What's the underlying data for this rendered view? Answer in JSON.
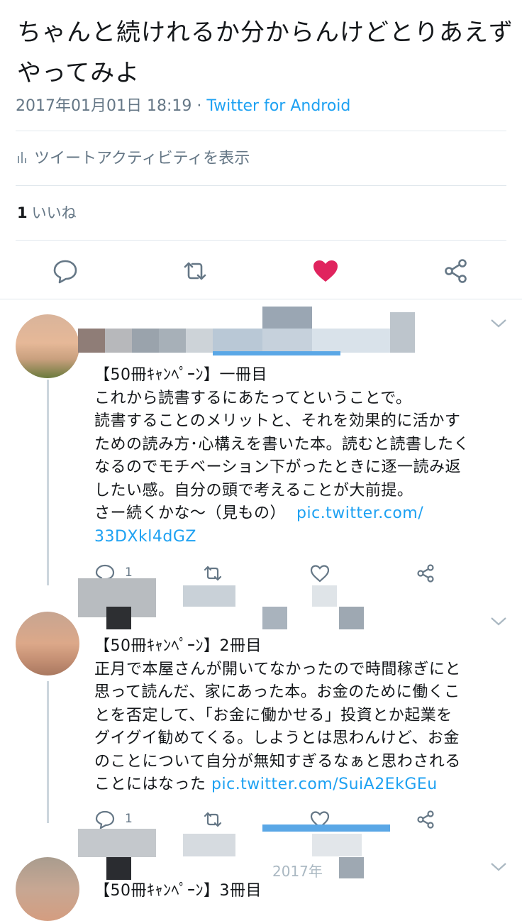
{
  "main_tweet": {
    "text": "ちゃんと続けれるか分からんけどとりあえずやってみよ",
    "timestamp": "2017年01月01日 18:19",
    "separator": " · ",
    "source": "Twitter for Android",
    "activity_label": "ツイートアクティビティを表示",
    "like_count": "1",
    "like_label": "いいね",
    "icons": [
      "reply-icon",
      "retweet-icon",
      "like-icon-filled",
      "share-icon"
    ],
    "like_color": "#e0245e"
  },
  "replies": [
    {
      "title": "【50冊ｷｬﾝﾍﾟｰﾝ】一冊目",
      "body_lines": [
        "これから読書するにあたってということで。",
        "読書することのメリットと、それを効果的に活かす",
        "ための読み方･心構えを書いた本。読むと読書したく",
        "なるのでモチベーション下がったときに逐一読み返",
        "したい感。自分の頭で考えることが大前提。"
      ],
      "last_line": "さー続くかな〜（見もの）",
      "link_part1": "pic.twitter.com/",
      "link_part2": "33DXkl4dGZ",
      "reply_count": "1"
    },
    {
      "title": "【50冊ｷｬﾝﾍﾟｰﾝ】2冊目",
      "body_lines": [
        "正月で本屋さんが開いてなかったので時間稼ぎにと",
        "思って読んだ、家にあった本。お金のために働くこ",
        "とを否定して、「お金に働かせる」投資とか起業を",
        "グイグイ勧めてくる。しようとは思わんけど、お金",
        "のことについて自分が無知すぎるなぁと思わされる"
      ],
      "last_line": "ことにはなった",
      "link": "pic.twitter.com/SuiA2EkGEu",
      "reply_count": "1"
    },
    {
      "title": "【50冊ｷｬﾝﾍﾟｰﾝ】3冊目",
      "timestamp_partial": "2017年"
    }
  ],
  "colors": {
    "link": "#1da1f2",
    "secondary_text": "#657786",
    "divider": "#e1e8ed",
    "like_active": "#e0245e"
  }
}
